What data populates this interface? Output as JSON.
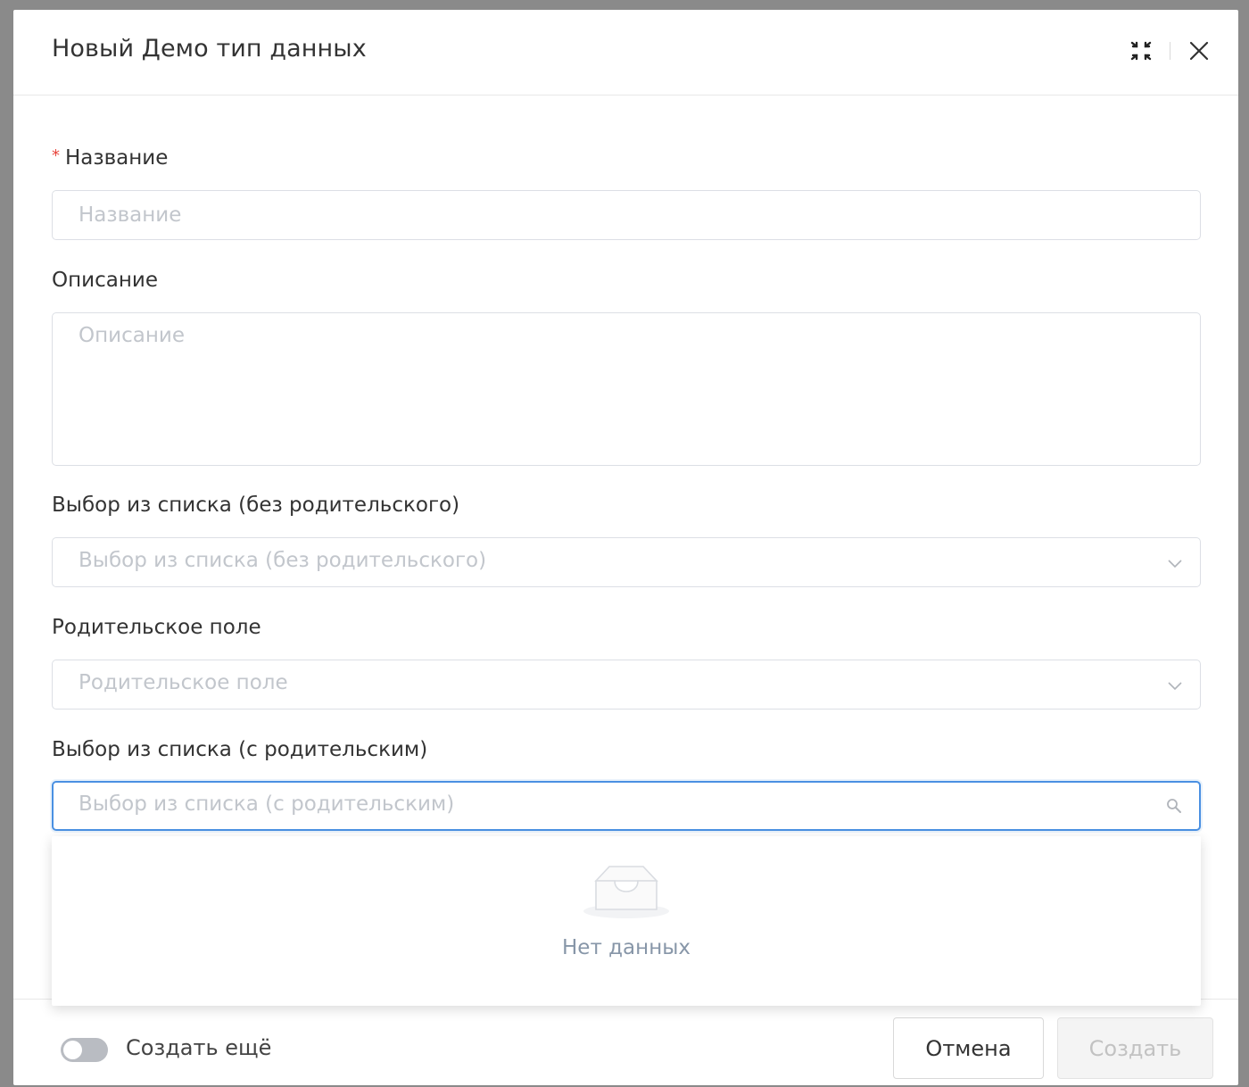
{
  "modal": {
    "title": "Новый Демо тип данных"
  },
  "form": {
    "name": {
      "label": "Название",
      "required_mark": "*",
      "placeholder": "Название"
    },
    "description": {
      "label": "Описание",
      "placeholder": "Описание"
    },
    "list_no_parent": {
      "label": "Выбор из списка (без родительского)",
      "placeholder": "Выбор из списка (без родительского)"
    },
    "parent_field": {
      "label": "Родительское поле",
      "placeholder": "Родительское поле"
    },
    "list_with_parent": {
      "label": "Выбор из списка (с родительским)",
      "placeholder": "Выбор из списка (с родительским)"
    }
  },
  "dropdown": {
    "empty_text": "Нет данных"
  },
  "footer": {
    "toggle_label": "Создать ещё",
    "toggle_on": false,
    "cancel_label": "Отмена",
    "create_label": "Создать"
  },
  "icons": {
    "collapse": "collapse-icon",
    "close": "close-icon",
    "chevron": "chevron-down-icon",
    "search": "search-icon",
    "empty": "empty-inbox-icon"
  },
  "colors": {
    "focus_border": "#4a90e2",
    "required": "#e8453c",
    "placeholder": "#c2c6cc",
    "disabled_text": "#c2c2c2"
  }
}
